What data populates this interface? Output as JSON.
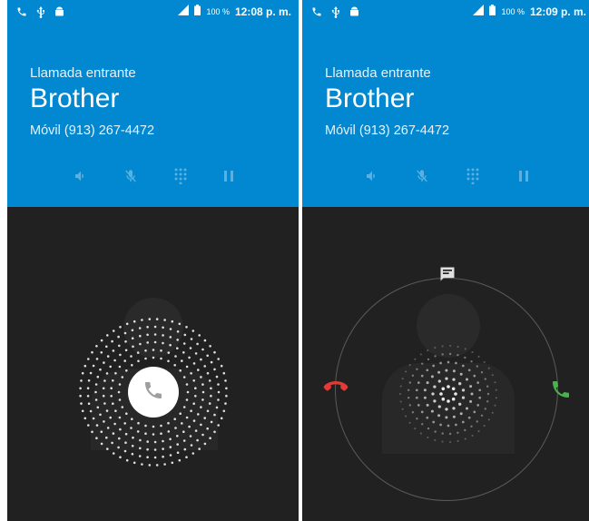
{
  "screens": [
    {
      "id": "left",
      "status_bar": {
        "battery": "100 %",
        "time": "12:08 p. m."
      },
      "call": {
        "state": "Llamada entrante",
        "caller": "Brother",
        "number": "Móvil (913) 267-4472"
      },
      "controls": [
        "speaker-icon",
        "mute-icon",
        "dialpad-icon",
        "hold-icon"
      ],
      "answer_icon": "phone-icon"
    },
    {
      "id": "right",
      "status_bar": {
        "battery": "100 %",
        "time": "12:09 p. m."
      },
      "call": {
        "state": "Llamada entrante",
        "caller": "Brother",
        "number": "Móvil (913) 267-4472"
      },
      "controls": [
        "speaker-icon",
        "mute-icon",
        "dialpad-icon",
        "hold-icon"
      ],
      "targets": [
        "message-icon",
        "decline-icon",
        "answer-icon"
      ]
    }
  ],
  "colors": {
    "header": "#0288d1",
    "background": "#212121",
    "answer": "#4caf50",
    "decline": "#e53935",
    "separator": "#ffffff"
  }
}
